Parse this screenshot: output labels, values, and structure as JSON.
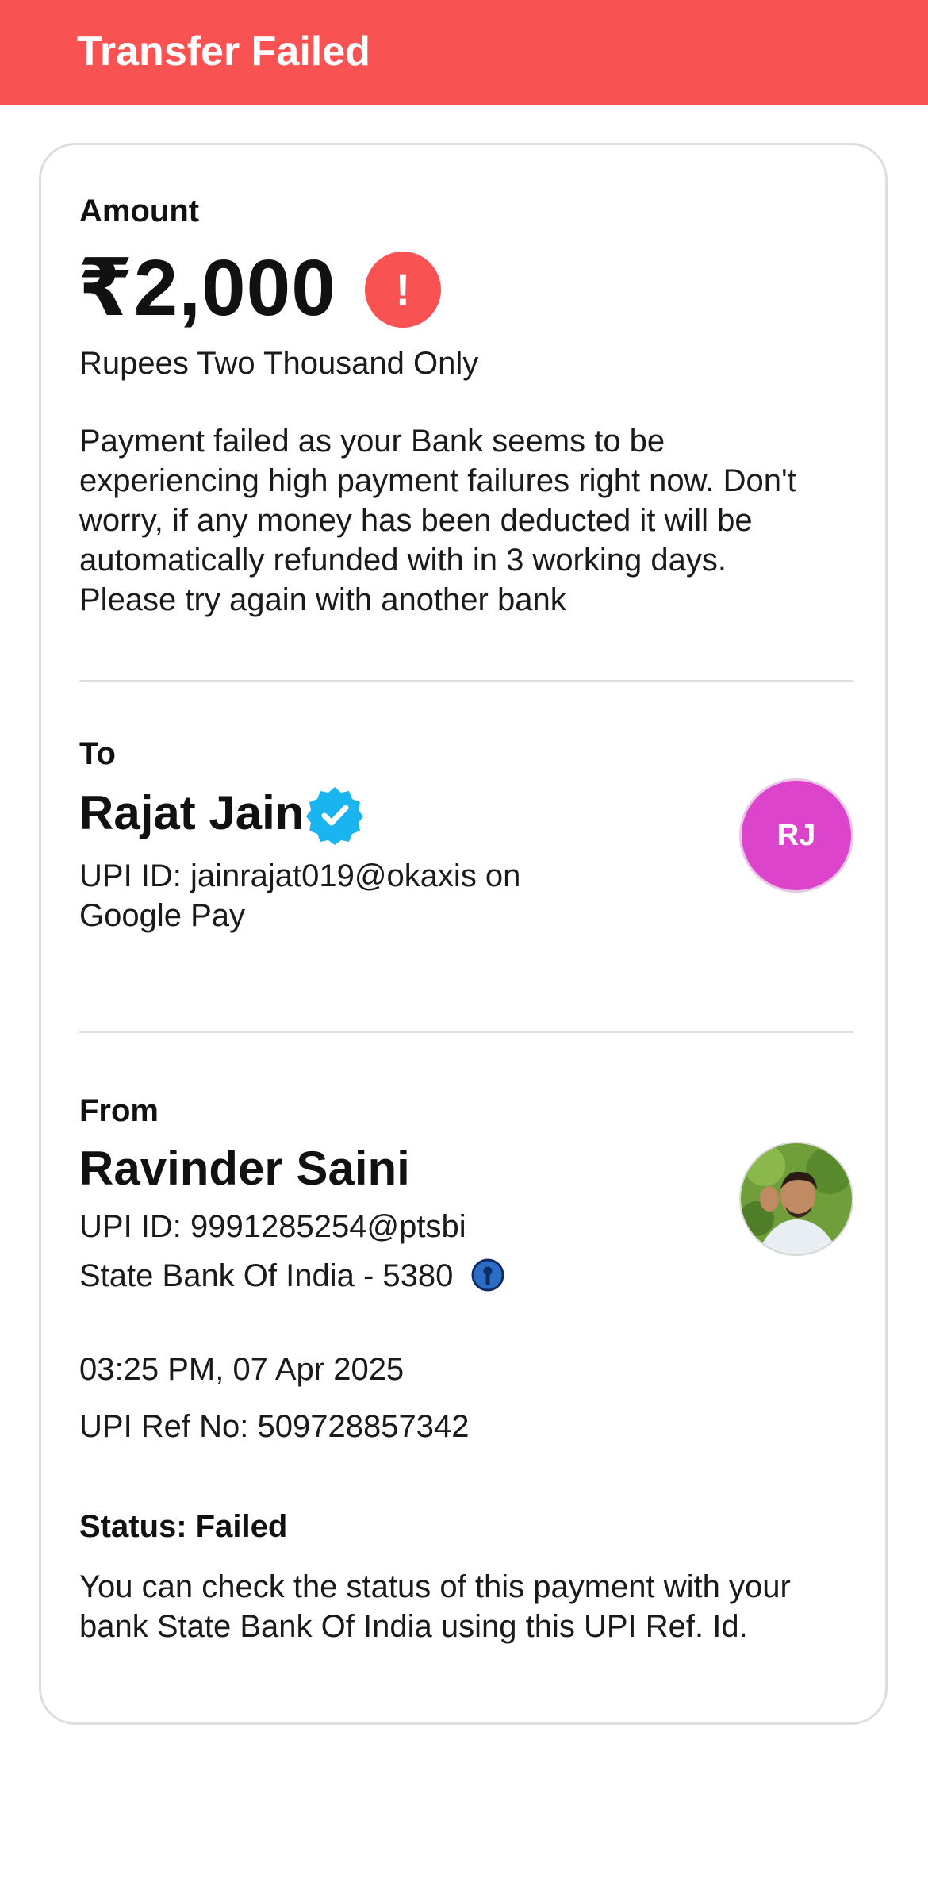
{
  "header": {
    "title": "Transfer Failed",
    "color": "#f85253"
  },
  "amount": {
    "label": "Amount",
    "value": "₹2,000",
    "status_icon": "alert-icon",
    "status_icon_glyph": "!",
    "in_words": "Rupees Two Thousand Only",
    "message": "Payment failed as your Bank seems to be experiencing high payment failures right now. Don't worry, if any money has been deducted it will be automatically refunded with in 3 working days. Please try again with another bank"
  },
  "to": {
    "label": "To",
    "name": "Rajat Jain",
    "verified_icon": "verified-badge-icon",
    "upi_line": "UPI ID: jainrajat019@okaxis on Google Pay",
    "avatar_initials": "RJ",
    "avatar_color": "#dd44cc"
  },
  "from": {
    "label": "From",
    "name": "Ravinder Saini",
    "upi_id": "UPI ID: 9991285254@ptsbi",
    "bank": "State Bank Of India - 5380",
    "bank_icon": "sbi-logo-icon",
    "avatar": "profile-photo"
  },
  "details": {
    "datetime": "03:25 PM, 07 Apr 2025",
    "ref_no": "UPI Ref No: 509728857342"
  },
  "status": {
    "label": "Status: Failed",
    "note": "You can check the status of this payment with your bank State Bank Of India using this UPI Ref. Id."
  }
}
